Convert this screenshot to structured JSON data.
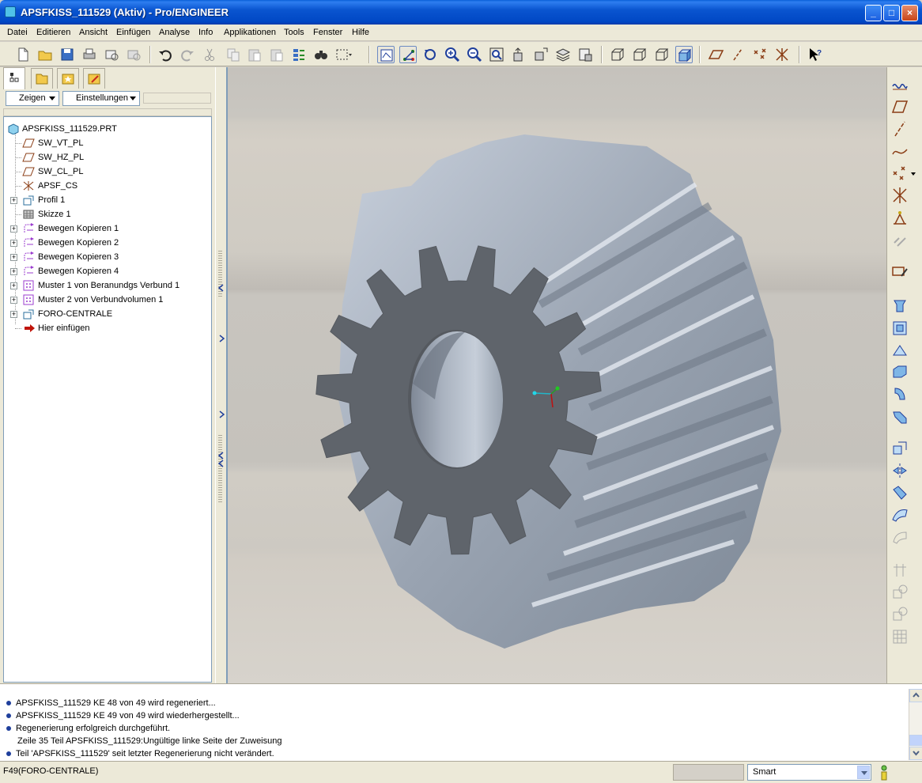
{
  "window": {
    "title": "APSFKISS_111529 (Aktiv) - Pro/ENGINEER"
  },
  "menu": [
    "Datei",
    "Editieren",
    "Ansicht",
    "Einfügen",
    "Analyse",
    "Info",
    "Applikationen",
    "Tools",
    "Fenster",
    "Hilfe"
  ],
  "left_panel": {
    "show_label": "Zeigen",
    "settings_label": "Einstellungen",
    "model_tree": [
      {
        "label": "APSFKISS_111529.PRT",
        "icon": "part-icon",
        "expandable": false,
        "level": 0
      },
      {
        "label": "SW_VT_PL",
        "icon": "datum-plane-icon",
        "expandable": false,
        "level": 1
      },
      {
        "label": "SW_HZ_PL",
        "icon": "datum-plane-icon",
        "expandable": false,
        "level": 1
      },
      {
        "label": "SW_CL_PL",
        "icon": "datum-plane-icon",
        "expandable": false,
        "level": 1
      },
      {
        "label": "APSF_CS",
        "icon": "coordinate-system-icon",
        "expandable": false,
        "level": 1
      },
      {
        "label": "Profil 1",
        "icon": "profile-icon",
        "expandable": true,
        "level": 1
      },
      {
        "label": "Skizze 1",
        "icon": "sketch-icon",
        "expandable": false,
        "level": 1
      },
      {
        "label": "Bewegen Kopieren 1",
        "icon": "move-copy-icon",
        "expandable": true,
        "level": 1
      },
      {
        "label": "Bewegen Kopieren 2",
        "icon": "move-copy-icon",
        "expandable": true,
        "level": 1
      },
      {
        "label": "Bewegen Kopieren 3",
        "icon": "move-copy-icon",
        "expandable": true,
        "level": 1
      },
      {
        "label": "Bewegen Kopieren 4",
        "icon": "move-copy-icon",
        "expandable": true,
        "level": 1
      },
      {
        "label": "Muster 1 von Beranundgs Verbund 1",
        "icon": "pattern-icon",
        "expandable": true,
        "level": 1
      },
      {
        "label": "Muster 2 von Verbundvolumen 1",
        "icon": "pattern-icon",
        "expandable": true,
        "level": 1
      },
      {
        "label": "FORO-CENTRALE",
        "icon": "hole-icon",
        "expandable": true,
        "level": 1
      },
      {
        "label": "Hier einfügen",
        "icon": "insert-arrow-icon",
        "expandable": false,
        "level": 1
      }
    ]
  },
  "messages": [
    {
      "text": "APSFKISS_111529 KE 48 von 49 wird regeneriert...",
      "bullet": true
    },
    {
      "text": "APSFKISS_111529 KE 49 von 49 wird wiederhergestellt...",
      "bullet": true
    },
    {
      "text": "Regenerierung erfolgreich durchgeführt.",
      "bullet": true
    },
    {
      "text": "Zeile 35 Teil APSFKISS_111529:Ungültige linke Seite der Zuweisung",
      "bullet": false
    },
    {
      "text": "Teil 'APSFKISS_111529' seit letzter Regenerierung nicht verändert.",
      "bullet": true
    }
  ],
  "status": {
    "text": "F49(FORO-CENTRALE)",
    "filter_value": "Smart"
  },
  "colors": {
    "title_bar": "#0a55d0",
    "gear_face": "#5f646b",
    "gear_teeth": "#aab4c2",
    "message_bullet": "#1f3f9c"
  }
}
